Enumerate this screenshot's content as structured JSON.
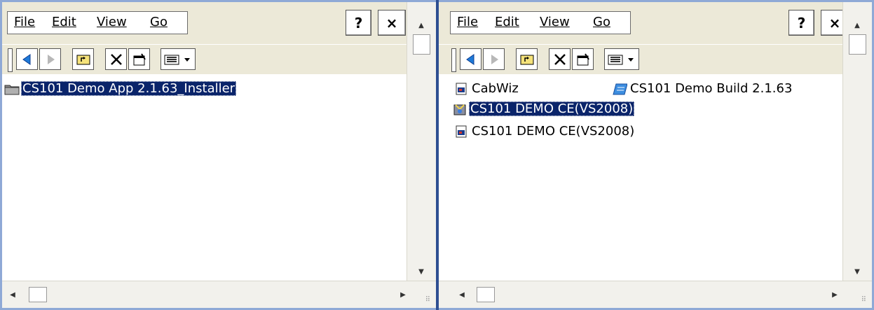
{
  "menus": [
    "File",
    "Edit",
    "View",
    "Go"
  ],
  "help_label": "?",
  "close_label": "×",
  "left": {
    "items": [
      {
        "name": "CS101 Demo App 2.1.63_Installer",
        "type": "folder",
        "selected": true
      }
    ]
  },
  "right": {
    "items": [
      {
        "name": "CabWiz",
        "type": "exe",
        "selected": false
      },
      {
        "name": "CS101 Demo Build 2.1.63",
        "type": "doc",
        "selected": false
      },
      {
        "name": "CS101 DEMO CE(VS2008)",
        "type": "setup",
        "selected": true
      },
      {
        "name": "CS101 DEMO CE(VS2008)",
        "type": "exe",
        "selected": false
      }
    ]
  },
  "colors": {
    "selection": "#0a246a",
    "chrome": "#ece9d8",
    "window_border": "#8fa9d6"
  }
}
